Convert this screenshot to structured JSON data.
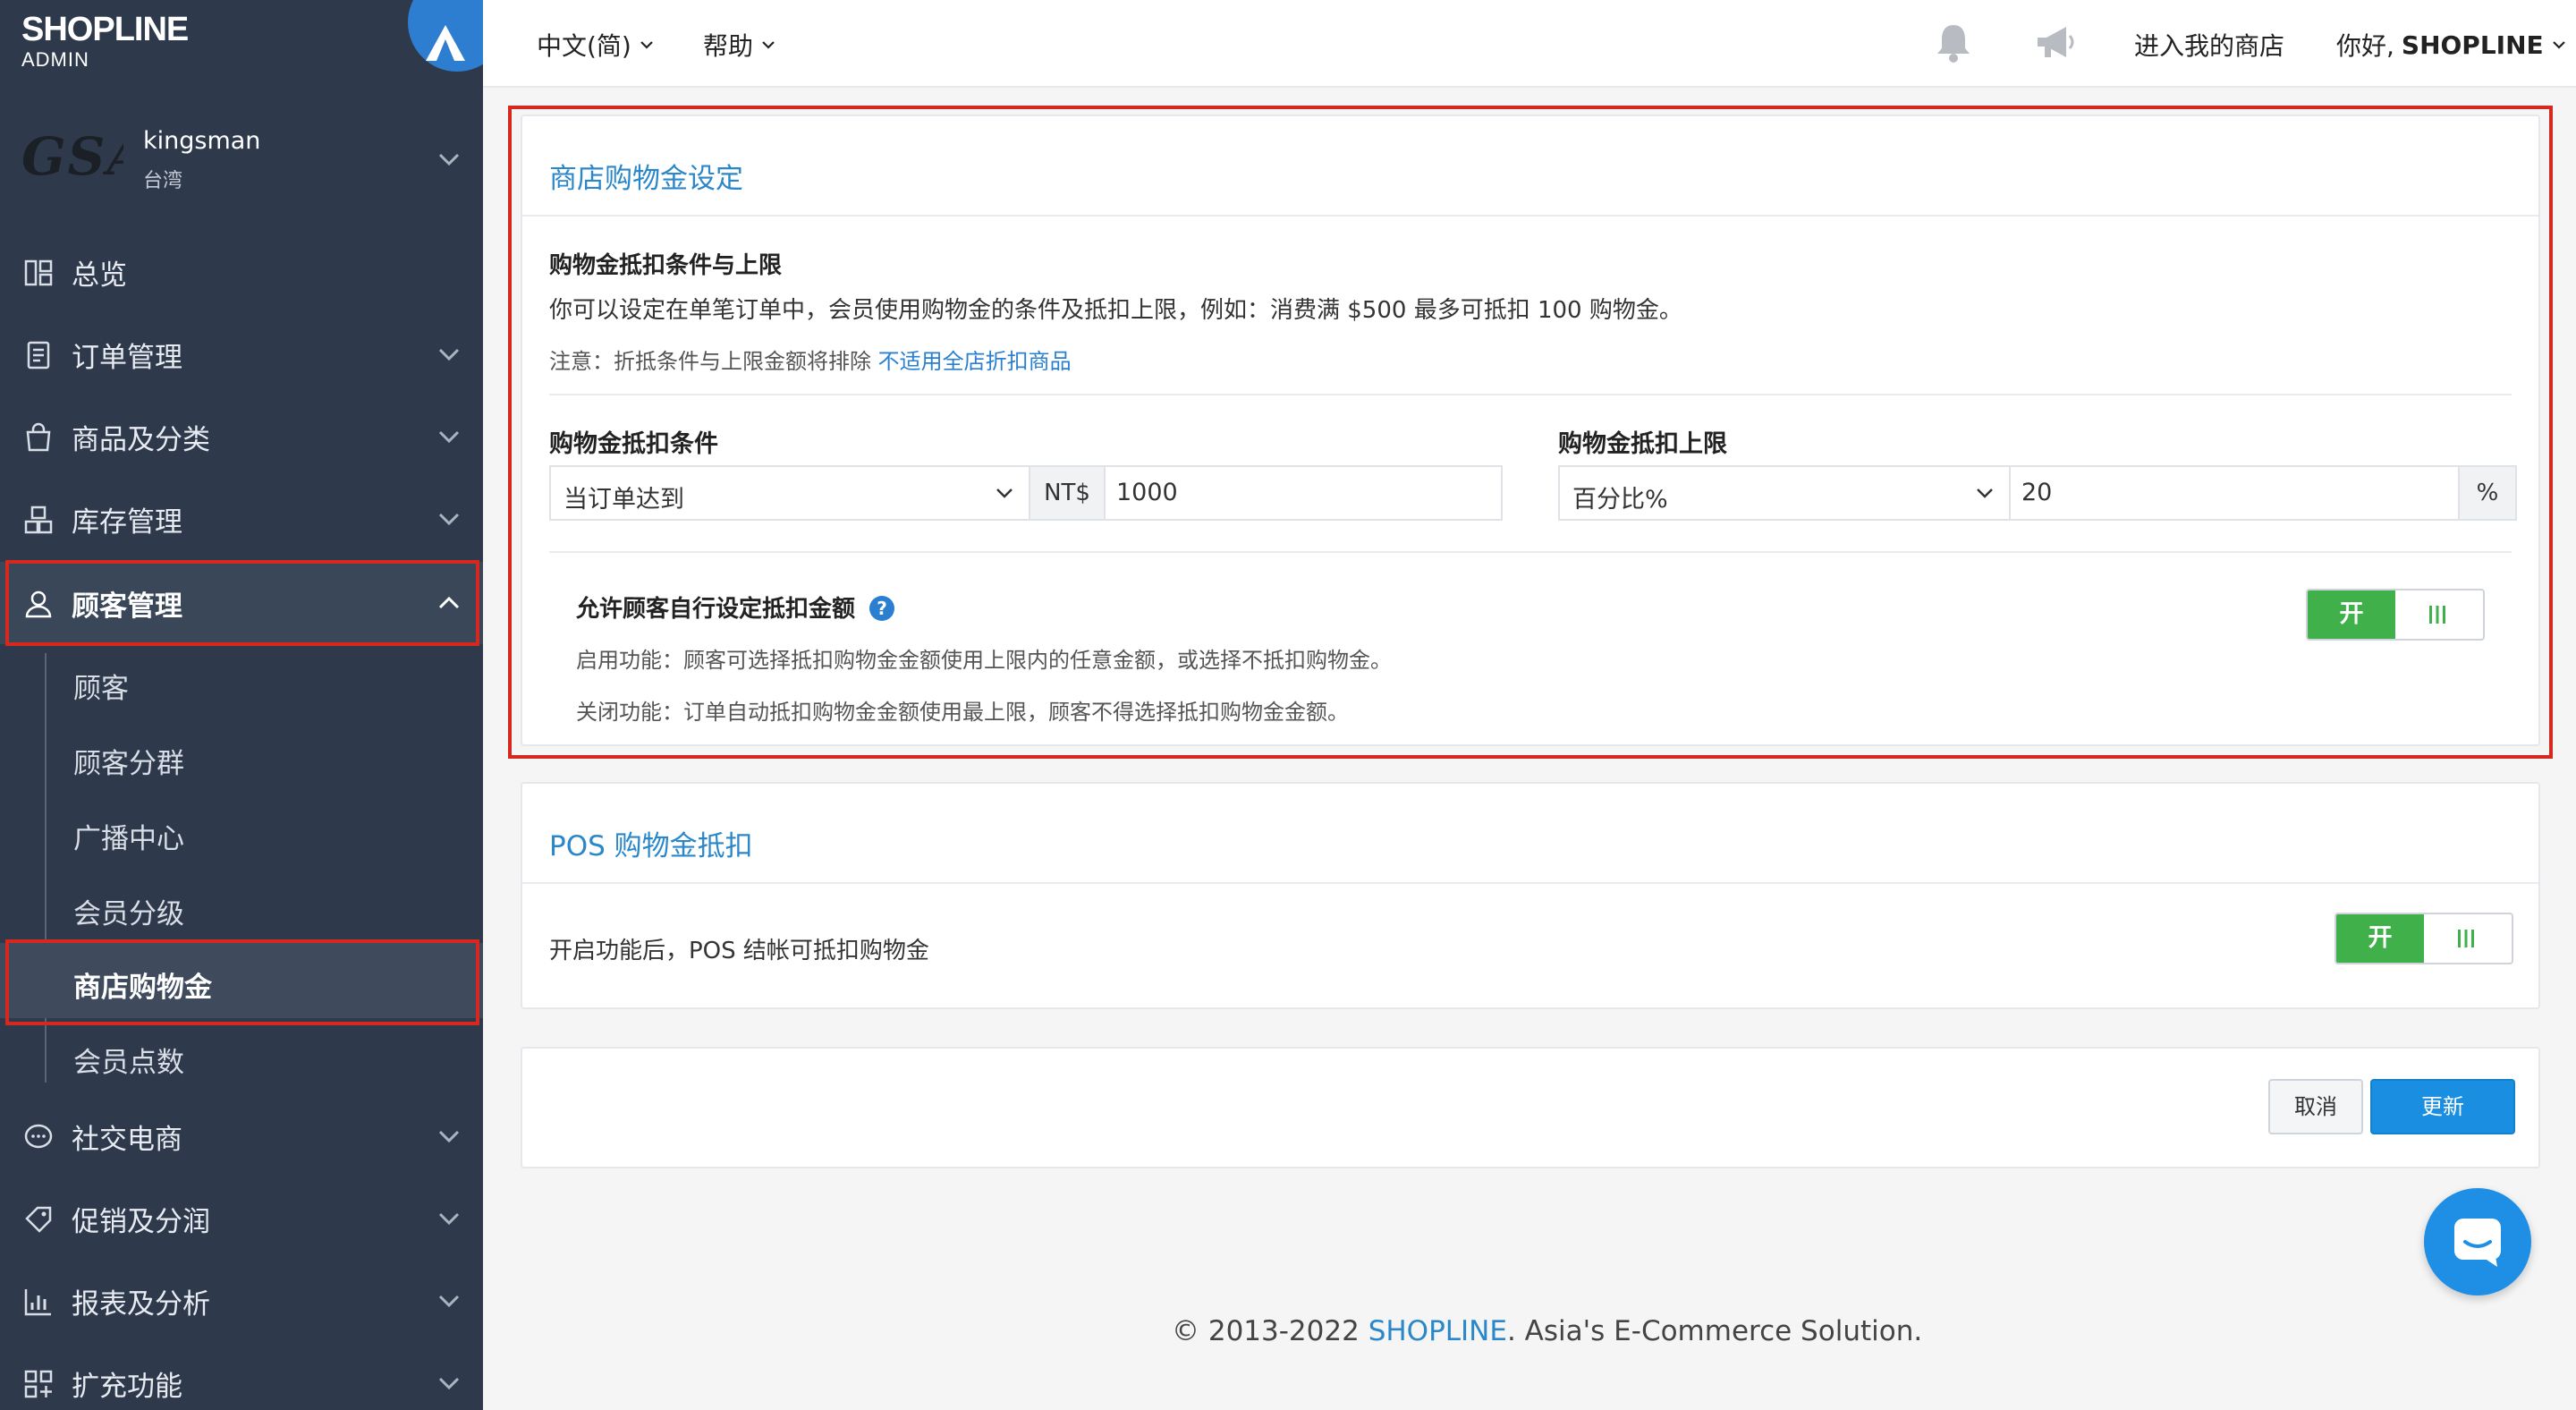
{
  "brand": {
    "name": "SHOPLINE",
    "sub": "ADMIN"
  },
  "shop": {
    "logo_text": "GSA",
    "name": "kingsman",
    "region": "台湾"
  },
  "nav": {
    "overview": "总览",
    "orders": "订单管理",
    "products": "商品及分类",
    "inventory": "库存管理",
    "customers": "顾客管理",
    "customer_sub": [
      "顾客",
      "顾客分群",
      "广播中心",
      "会员分级",
      "商店购物金",
      "会员点数"
    ],
    "social": "社交电商",
    "promotions": "促销及分润",
    "reports": "报表及分析",
    "apps": "扩充功能"
  },
  "topbar": {
    "language": "中文(简)",
    "help": "帮助",
    "enter_store": "进入我的商店",
    "greeting": "你好,",
    "user": "SHOPLINE",
    "bell_icon": "bell-icon",
    "megaphone_icon": "megaphone-icon"
  },
  "credit_settings": {
    "title": "商店购物金设定",
    "section_title": "购物金抵扣条件与上限",
    "description": "你可以设定在单笔订单中，会员使用购物金的条件及抵扣上限，例如：消费满 $500 最多可抵扣 100 购物金。",
    "note_prefix": "注意：折抵条件与上限金额将排除 ",
    "note_link": "不适用全店折扣商品",
    "condition_label": "购物金抵扣条件",
    "condition_select": "当订单达到",
    "currency": "NT$",
    "condition_value": "1000",
    "limit_label": "购物金抵扣上限",
    "limit_select": "百分比%",
    "limit_value": "20",
    "limit_unit": "%",
    "allow_title": "允许顾客自行设定抵扣金额",
    "allow_on_desc": "启用功能：顾客可选择抵扣购物金金额使用上限内的任意金额，或选择不抵扣购物金。",
    "allow_off_desc": "关闭功能：订单自动抵扣购物金金额使用最上限，顾客不得选择抵扣购物金金额。",
    "toggle_on": "开"
  },
  "pos": {
    "title": "POS 购物金抵扣",
    "description": "开启功能后，POS 结帐可抵扣购物金",
    "toggle_on": "开"
  },
  "actions": {
    "cancel": "取消",
    "update": "更新"
  },
  "footer": {
    "prefix": "© 2013-2022 ",
    "brand": "SHOPLINE",
    "suffix": ". Asia's E-Commerce Solution."
  },
  "colors": {
    "sidebar": "#2e3a4b",
    "accent": "#2a87c9",
    "toggle_on": "#3fb04a",
    "highlight": "#d6281e",
    "primary_button": "#1a8ee0"
  }
}
